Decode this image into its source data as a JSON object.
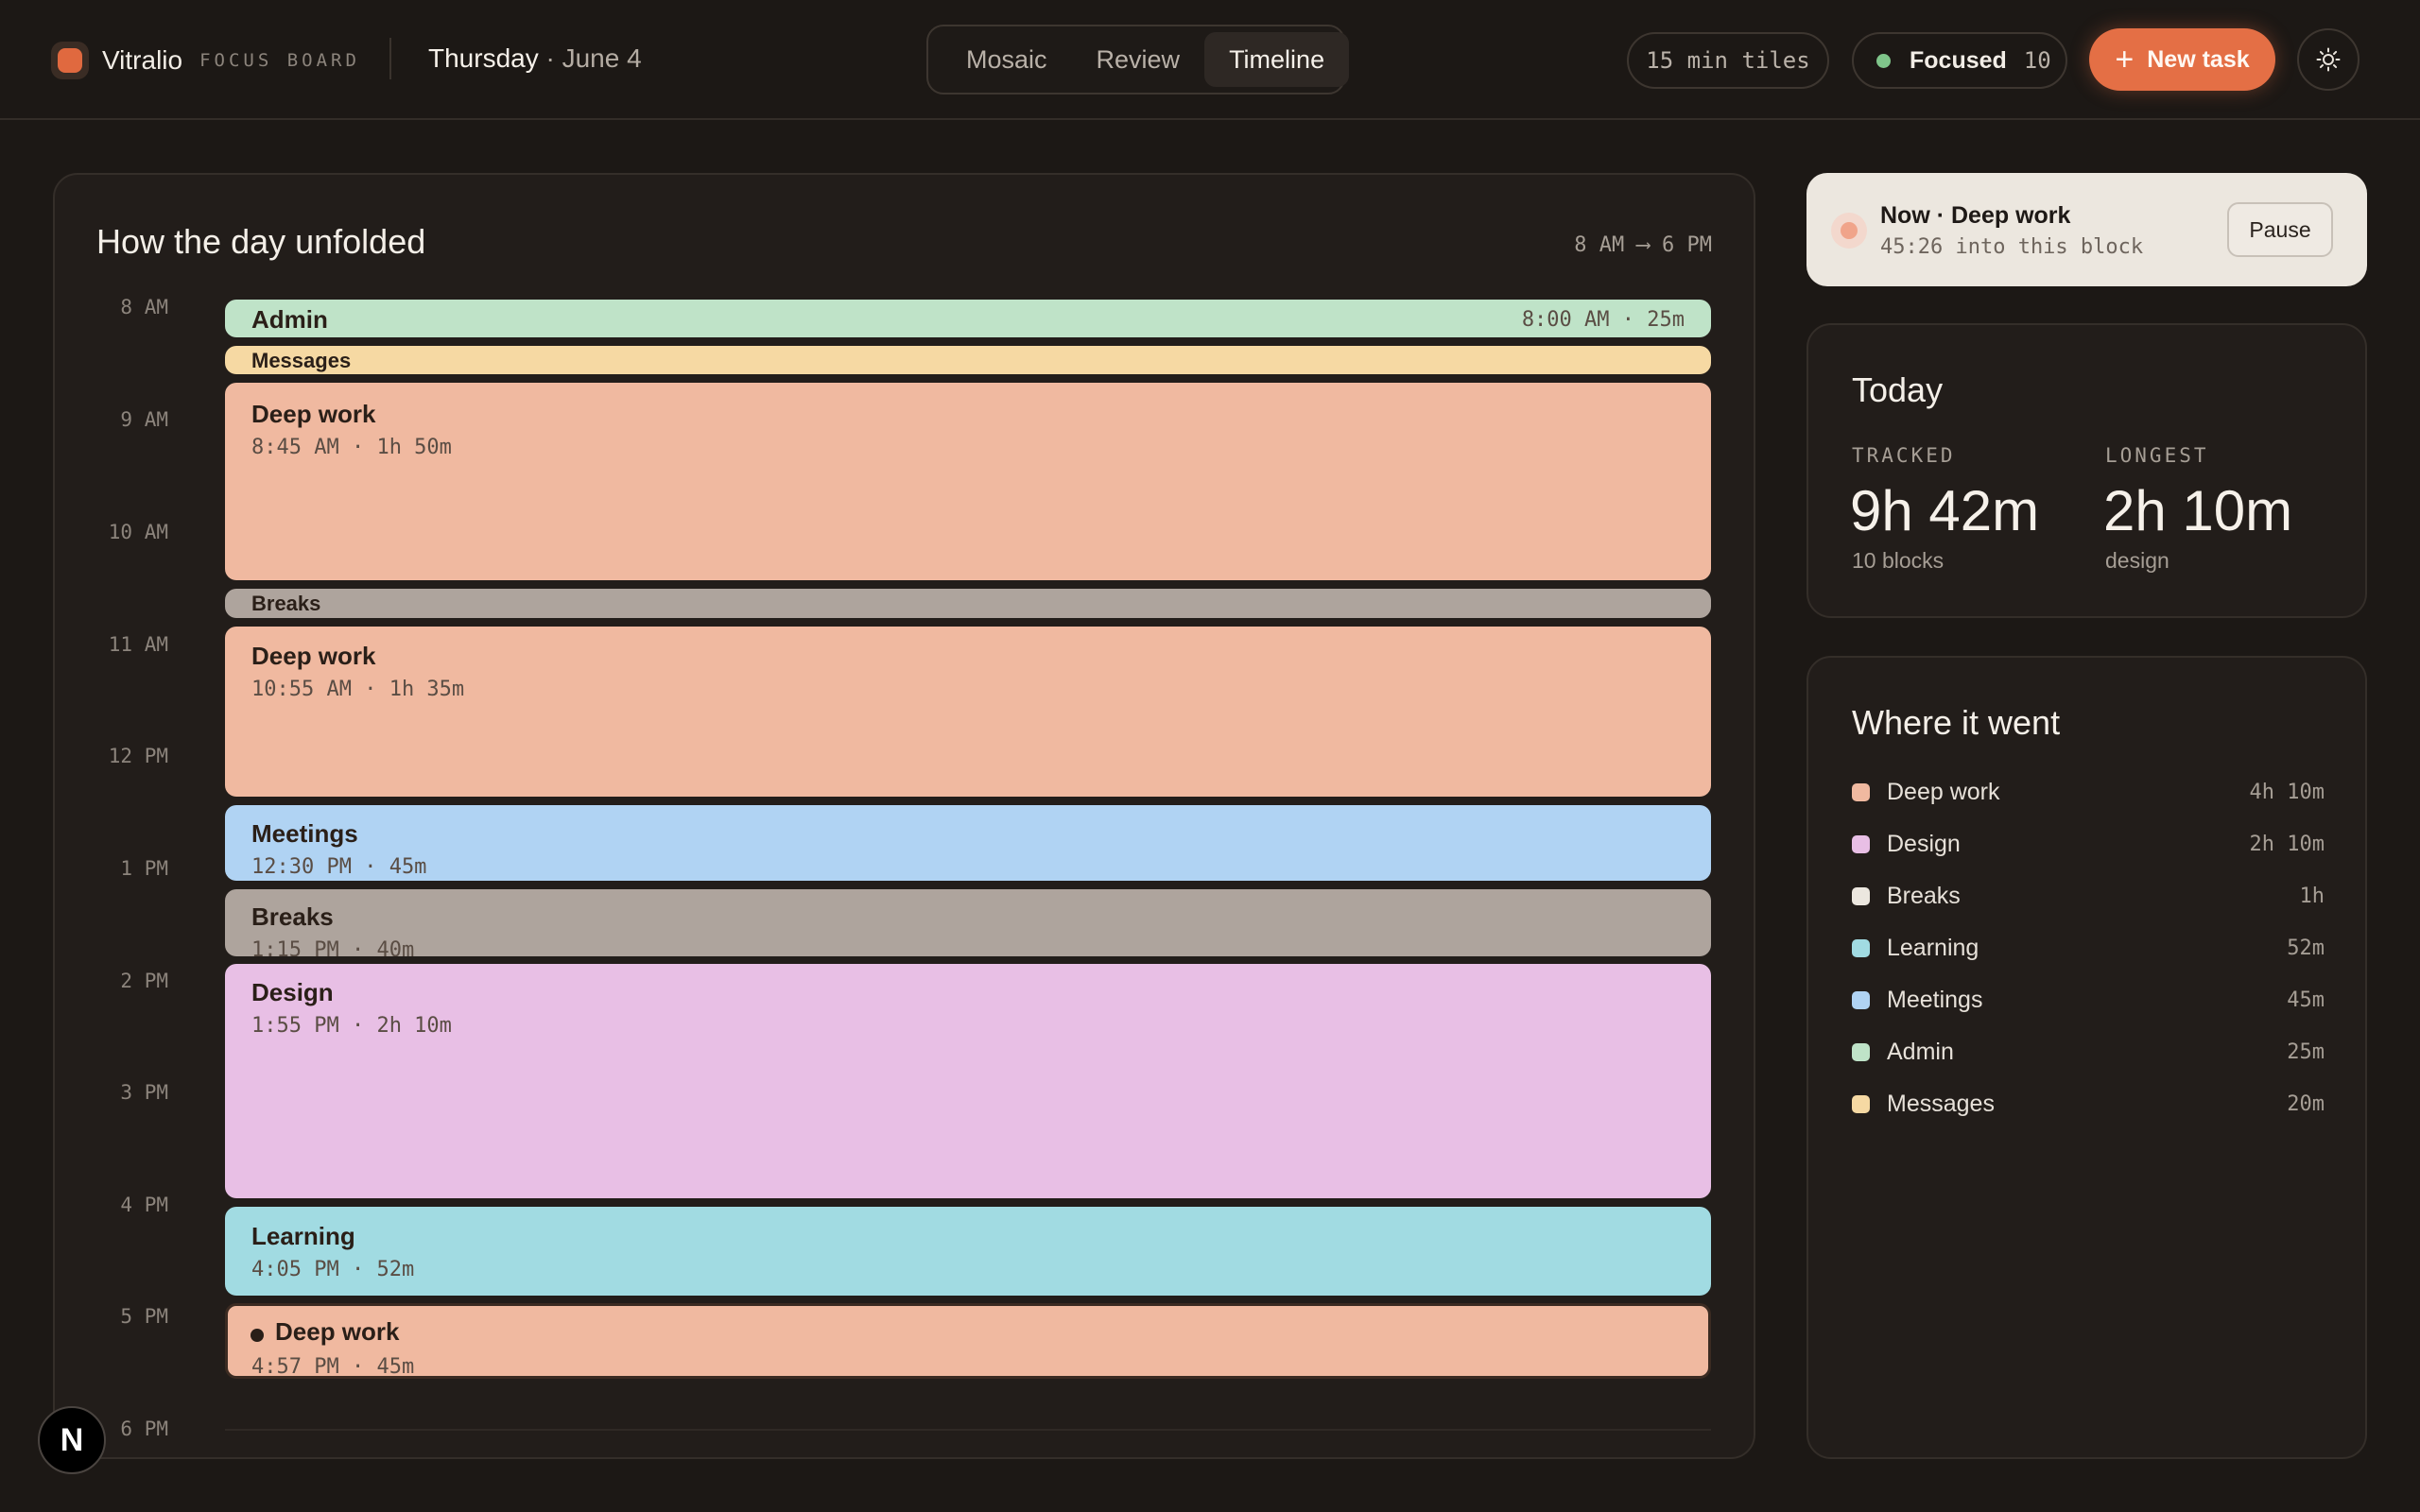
{
  "brand": {
    "name": "Vitralio",
    "subtitle": "FOCUS BOARD"
  },
  "date": {
    "day": "Thursday",
    "separator": "·",
    "month_day": "June 4"
  },
  "tabs": [
    {
      "label": "Mosaic",
      "active": false
    },
    {
      "label": "Review",
      "active": false
    },
    {
      "label": "Timeline",
      "active": true
    }
  ],
  "tiles_pill": "15 min tiles",
  "focused": {
    "label": "Focused",
    "count": "10",
    "status_color": "#7fc58a"
  },
  "new_task": "New task",
  "timeline": {
    "title": "How the day unfolded",
    "range": "8 AM ⟶ 6 PM",
    "hours": [
      "8 AM",
      "9 AM",
      "10 AM",
      "11 AM",
      "12 PM",
      "1 PM",
      "2 PM",
      "3 PM",
      "4 PM",
      "5 PM",
      "6 PM"
    ],
    "blocks": [
      {
        "name": "Admin",
        "meta": "8:00 AM · 25m",
        "category": "admin"
      },
      {
        "name": "Messages",
        "meta": "",
        "category": "messages"
      },
      {
        "name": "Deep work",
        "meta": "8:45 AM · 1h 50m",
        "category": "deep"
      },
      {
        "name": "Breaks",
        "meta": "",
        "category": "breaks"
      },
      {
        "name": "Deep work",
        "meta": "10:55 AM · 1h 35m",
        "category": "deep"
      },
      {
        "name": "Meetings",
        "meta": "12:30 PM · 45m",
        "category": "meetings"
      },
      {
        "name": "Breaks",
        "meta": "1:15 PM · 40m",
        "category": "breaks"
      },
      {
        "name": "Design",
        "meta": "1:55 PM · 2h 10m",
        "category": "design"
      },
      {
        "name": "Learning",
        "meta": "4:05 PM · 52m",
        "category": "learning"
      },
      {
        "name": "Deep work",
        "meta": "4:57 PM · 45m",
        "category": "deep",
        "current": true
      }
    ]
  },
  "now": {
    "title": "Now · Deep work",
    "subtitle": "45:26 into this block",
    "pause": "Pause"
  },
  "today": {
    "title": "Today",
    "tracked_label": "TRACKED",
    "tracked_value": "9h 42m",
    "tracked_sub": "10 blocks",
    "longest_label": "LONGEST",
    "longest_value": "2h 10m",
    "longest_sub": "design"
  },
  "where": {
    "title": "Where it went",
    "items": [
      {
        "name": "Deep work",
        "value": "4h 10m",
        "color": "#f0b9a0"
      },
      {
        "name": "Design",
        "value": "2h 10m",
        "color": "#e8bfe5"
      },
      {
        "name": "Breaks",
        "value": "1h",
        "color": "#ece7df"
      },
      {
        "name": "Learning",
        "value": "52m",
        "color": "#a1dbe2"
      },
      {
        "name": "Meetings",
        "value": "45m",
        "color": "#b0d3f3"
      },
      {
        "name": "Admin",
        "value": "25m",
        "color": "#bfe3c8"
      },
      {
        "name": "Messages",
        "value": "20m",
        "color": "#f6d9a3"
      }
    ]
  },
  "badge": "N"
}
